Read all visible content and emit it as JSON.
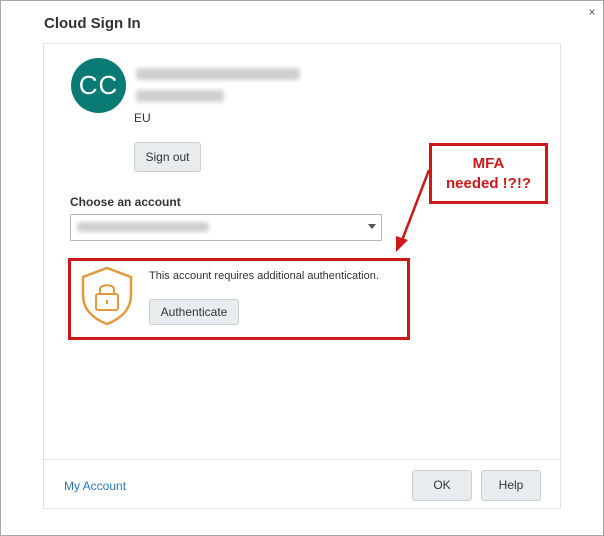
{
  "window": {
    "title": "Cloud Sign In",
    "close_glyph": "×"
  },
  "account": {
    "avatar_initials": "CC",
    "region": "EU"
  },
  "sign_out_label": "Sign out",
  "choose_account_label": "Choose an account",
  "auth": {
    "message": "This account requires additional authentication.",
    "authenticate_label": "Authenticate",
    "icon": "shield-lock-icon"
  },
  "footer": {
    "my_account_link": "My Account",
    "ok_label": "OK",
    "help_label": "Help"
  },
  "annotation": {
    "callout_line1": "MFA",
    "callout_line2": "needed !?!?",
    "color": "#cc1a1a"
  },
  "colors": {
    "avatar": "#0a7b74",
    "link": "#2b79b7",
    "shield": "#e09a3e"
  }
}
